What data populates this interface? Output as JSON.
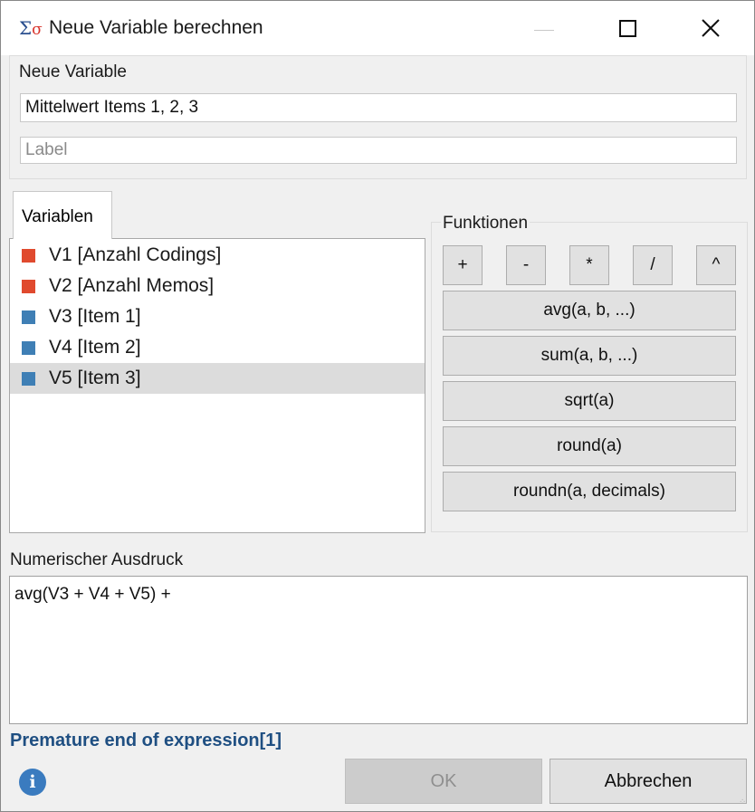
{
  "window": {
    "title": "Neue Variable berechnen",
    "icon_text": "Σ",
    "icon_sigma": "σ"
  },
  "new_variable": {
    "group_label": "Neue Variable",
    "name_value": "Mittelwert Items 1, 2, 3",
    "label_placeholder": "Label"
  },
  "variables": {
    "tab_label": "Variablen",
    "items": [
      {
        "label": "V1 [Anzahl Codings]",
        "color": "#e04a2e"
      },
      {
        "label": "V2 [Anzahl Memos]",
        "color": "#e04a2e"
      },
      {
        "label": "V3 [Item 1]",
        "color": "#3f7fb5"
      },
      {
        "label": "V4 [Item 2]",
        "color": "#3f7fb5"
      },
      {
        "label": "V5 [Item 3]",
        "color": "#3f7fb5",
        "selected": true
      }
    ]
  },
  "functions": {
    "group_label": "Funktionen",
    "operators": [
      "+",
      "-",
      "*",
      "/",
      "^"
    ],
    "items": [
      "avg(a, b, ...)",
      "sum(a, b, ...)",
      "sqrt(a)",
      "round(a)",
      "roundn(a, decimals)"
    ]
  },
  "expression": {
    "label": "Numerischer Ausdruck",
    "value": "avg(V3 + V4 + V5) +"
  },
  "status": {
    "error_text": "Premature end of expression[1]",
    "error_color": "#1f4f82"
  },
  "buttons": {
    "ok_label": "OK",
    "ok_enabled": false,
    "cancel_label": "Abbrechen"
  }
}
